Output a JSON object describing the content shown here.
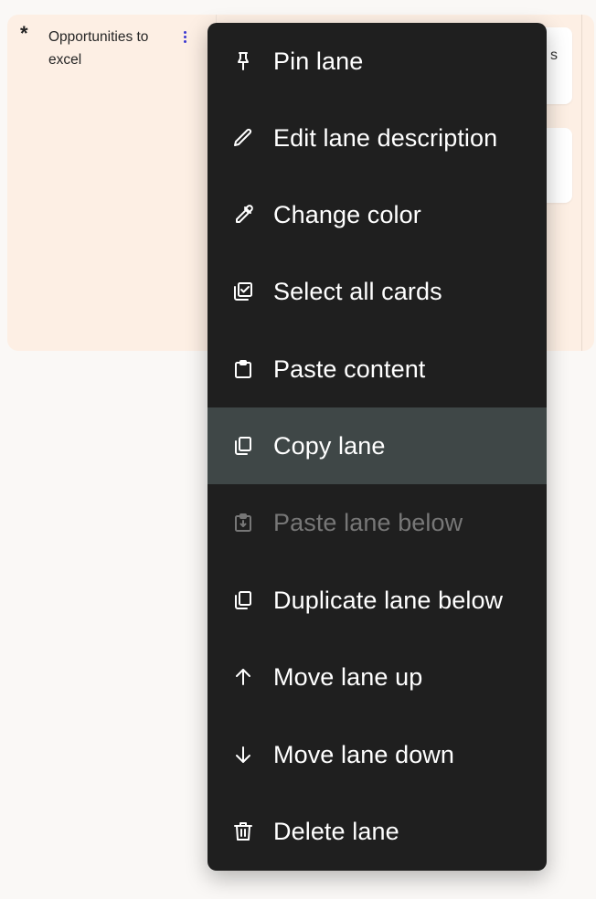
{
  "lane": {
    "title": "Opportunities to excel",
    "marker": "*",
    "card_partial_char": "s",
    "background": "#fdefe4"
  },
  "menu": {
    "background": "#1f1f1f",
    "highlight": "#3f4747",
    "items": [
      {
        "label": "Pin lane",
        "icon": "pin-icon",
        "state": "normal"
      },
      {
        "label": "Edit lane description",
        "icon": "pencil-icon",
        "state": "normal"
      },
      {
        "label": "Change color",
        "icon": "eyedropper-icon",
        "state": "normal"
      },
      {
        "label": "Select all cards",
        "icon": "select-all-icon",
        "state": "normal"
      },
      {
        "label": "Paste content",
        "icon": "clipboard-icon",
        "state": "normal"
      },
      {
        "label": "Copy lane",
        "icon": "copy-icon",
        "state": "highlighted"
      },
      {
        "label": "Paste lane below",
        "icon": "clipboard-down-icon",
        "state": "disabled"
      },
      {
        "label": "Duplicate lane below",
        "icon": "duplicate-icon",
        "state": "normal"
      },
      {
        "label": "Move lane up",
        "icon": "arrow-up-icon",
        "state": "normal"
      },
      {
        "label": "Move lane down",
        "icon": "arrow-down-icon",
        "state": "normal"
      },
      {
        "label": "Delete lane",
        "icon": "trash-icon",
        "state": "normal"
      }
    ]
  }
}
